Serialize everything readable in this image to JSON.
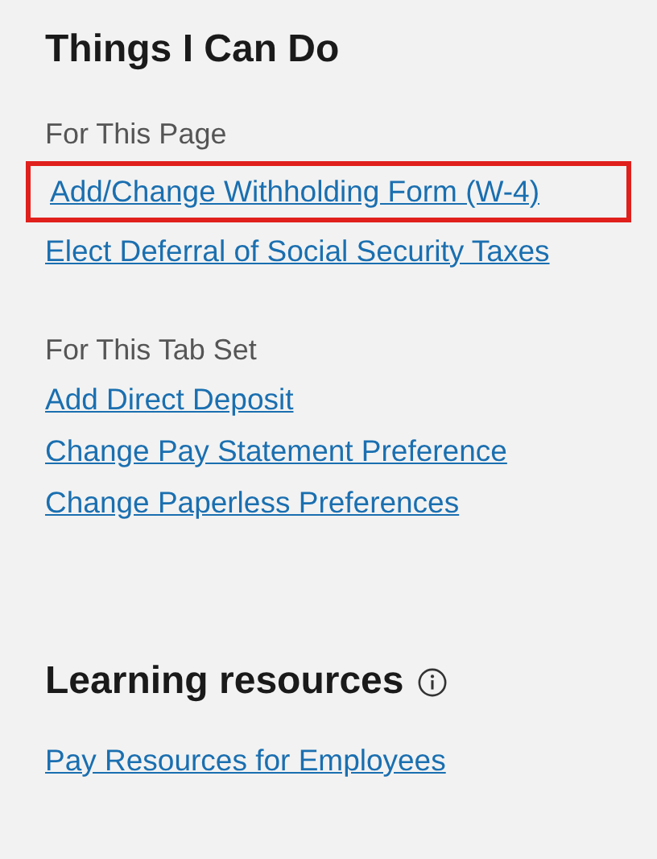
{
  "sections": [
    {
      "title": "Things I Can Do",
      "info": false,
      "groups": [
        {
          "label": "For This Page",
          "links": [
            {
              "text": "Add/Change Withholding Form (W-4)",
              "highlighted": true
            },
            {
              "text": "Elect Deferral of Social Security Taxes",
              "highlighted": false
            }
          ]
        },
        {
          "label": "For This Tab Set",
          "links": [
            {
              "text": "Add Direct Deposit",
              "highlighted": false
            },
            {
              "text": "Change Pay Statement Preference",
              "highlighted": false
            },
            {
              "text": "Change Paperless Preferences",
              "highlighted": false
            }
          ]
        }
      ]
    },
    {
      "title": "Learning resources",
      "info": true,
      "groups": [
        {
          "links": [
            {
              "text": "Pay Resources for Employees",
              "highlighted": false
            }
          ]
        }
      ]
    }
  ]
}
